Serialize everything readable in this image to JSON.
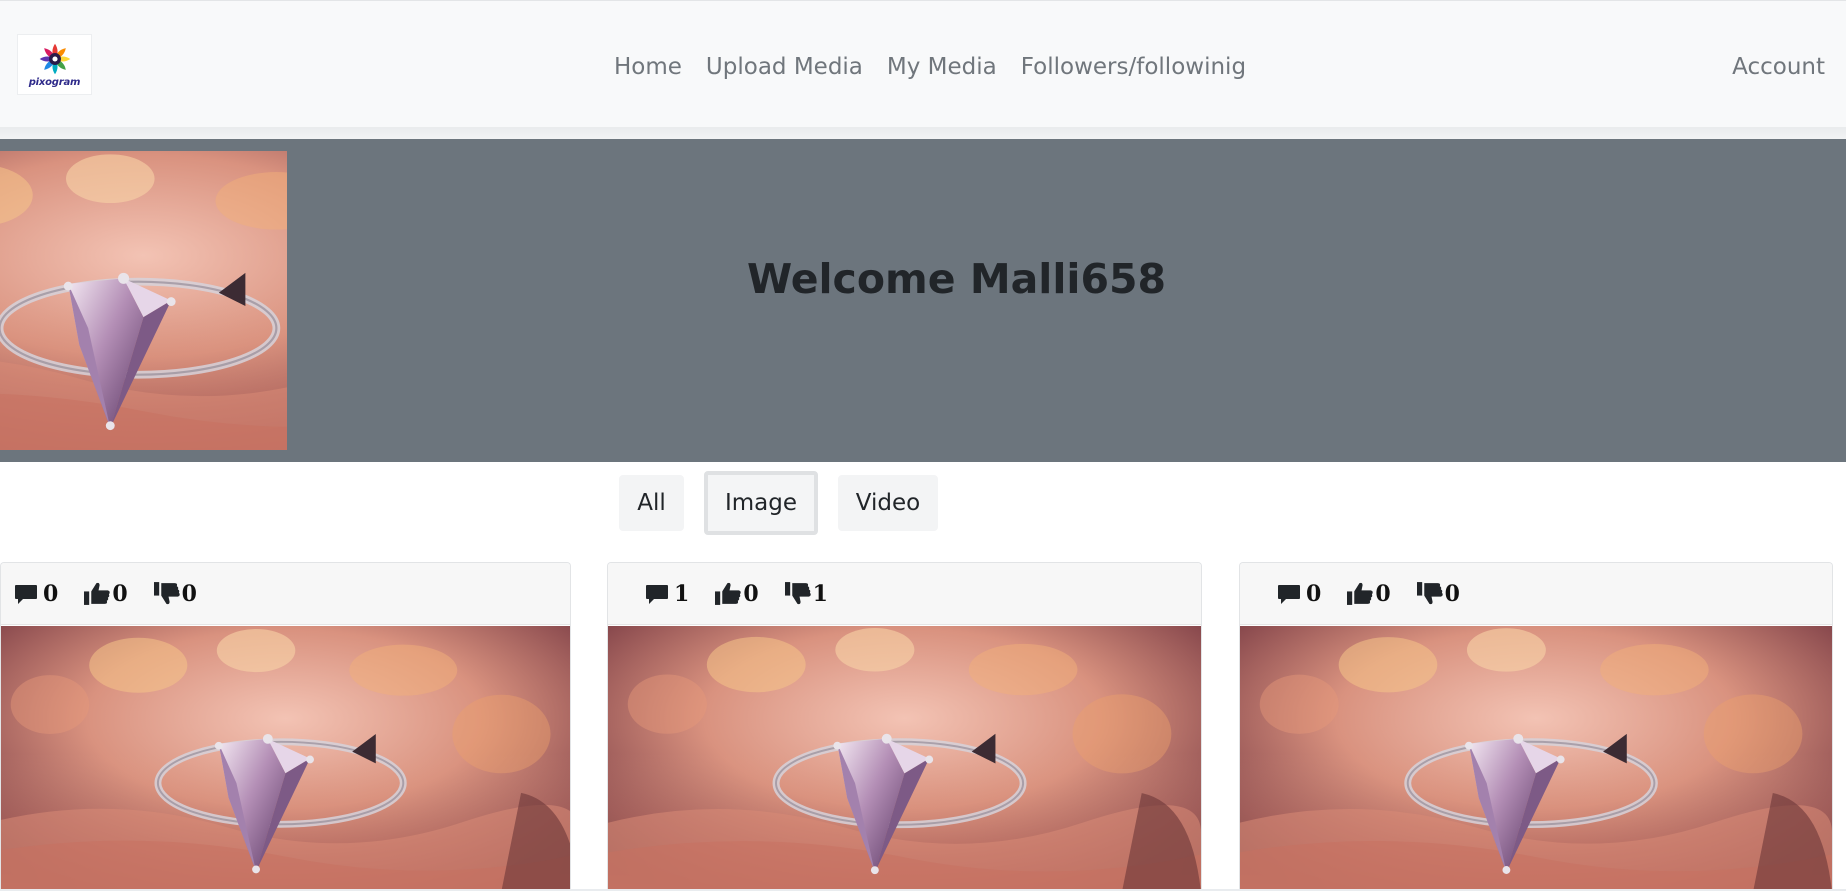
{
  "navbar": {
    "brand_text": "pixogram",
    "links": [
      "Home",
      "Upload Media",
      "My Media",
      "Followers/followinig"
    ],
    "account": "Account"
  },
  "banner": {
    "welcome": "Welcome Malli658"
  },
  "filters": [
    "All",
    "Image",
    "Video"
  ],
  "active_filter": "Image",
  "posts": [
    {
      "comments": "0",
      "likes": "0",
      "dislikes": "0"
    },
    {
      "comments": "1",
      "likes": "0",
      "dislikes": "1"
    },
    {
      "comments": "0",
      "likes": "0",
      "dislikes": "0"
    }
  ],
  "icons": {
    "comment": "comment-icon",
    "like": "thumbs-up-icon",
    "dislike": "thumbs-down-icon",
    "image": "ring-photo"
  },
  "colors": {
    "navbar_bg": "#f8f9fa",
    "banner_bg": "#6c757d",
    "nav_text": "#70767c"
  }
}
